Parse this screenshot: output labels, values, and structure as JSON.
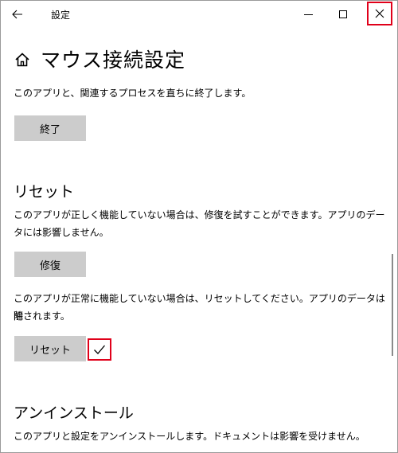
{
  "window": {
    "title": "設定"
  },
  "header": {
    "title": "マウス接続設定"
  },
  "terminate": {
    "description": "このアプリと、関連するプロセスを直ちに終了します。",
    "button_label": "終了"
  },
  "reset": {
    "section_title": "リセット",
    "repair_description_line1": "このアプリが正しく機能していない場合は、修復を試すことができます。アプリのデー",
    "repair_description_line2": "タには影響しません。",
    "repair_button_label": "修復",
    "reset_description_line1": "このアプリが正常に機能していない場合は、リセットしてください。アプリのデータは削",
    "reset_description_line2": "除されます。",
    "reset_button_label": "リセット"
  },
  "uninstall": {
    "section_title": "アンインストール",
    "description": "このアプリと設定をアンインストールします。ドキュメントは影響を受けません。"
  },
  "icons": {
    "back": "back-arrow-icon",
    "minimize": "minimize-icon",
    "maximize": "maximize-icon",
    "close": "close-icon",
    "home": "home-icon",
    "checkmark": "checkmark-icon"
  },
  "colors": {
    "highlight": "#e0001a",
    "button_bg": "#cccccc"
  }
}
